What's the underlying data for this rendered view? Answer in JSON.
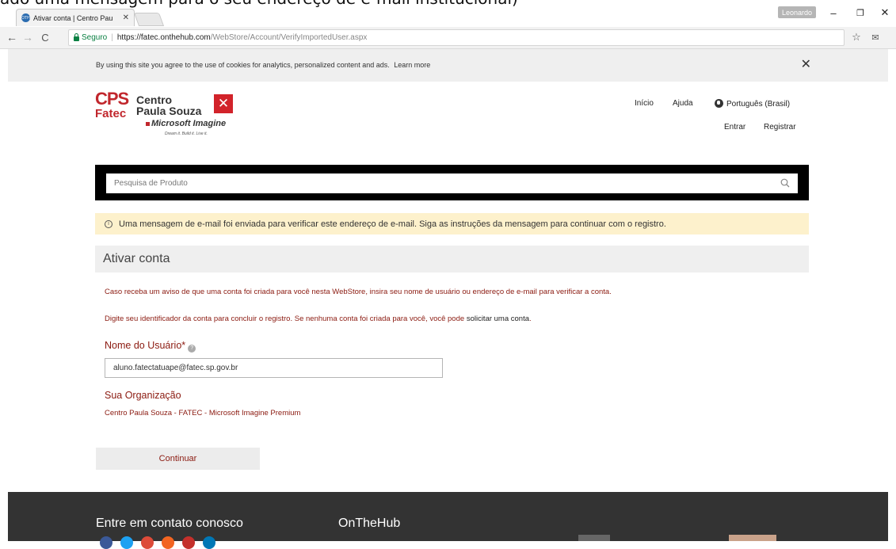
{
  "caption": "ado uma mensagem para o seu endereço de e-mail institucional)",
  "browser": {
    "tab_title": "Ativar conta | Centro Pau",
    "favicon_text": "OTH",
    "user_name": "Leonardo",
    "secure_label": "Seguro",
    "url_host": "https://fatec.onthehub.com",
    "url_path": "/WebStore/Account/VerifyImportedUser.aspx"
  },
  "cookie": {
    "text": "By using this site you agree to the use of cookies for analytics, personalized content and ads.",
    "link": "Learn more"
  },
  "logo": {
    "cps": "CPS",
    "fatec": "Fatec",
    "centro_line1": "Centro",
    "centro_line2": "Paula Souza",
    "imagine": "Microsoft Imagine",
    "tagline": "Dream it. Build it. Live it."
  },
  "nav": {
    "inicio": "Início",
    "ajuda": "Ajuda",
    "language": "Português (Brasil)",
    "entrar": "Entrar",
    "registrar": "Registrar"
  },
  "search": {
    "placeholder": "Pesquisa de Produto"
  },
  "alert": {
    "message": "Uma mensagem de e-mail foi enviada para verificar este endereço de e-mail. Siga as instruções da mensagem para continuar com o registro."
  },
  "section": {
    "title": "Ativar conta",
    "para1": "Caso receba um aviso de que uma conta foi criada para você nesta WebStore, insira seu nome de usuário ou endereço de e-mail para verificar a conta.",
    "para2_prefix": "Digite seu identificador da conta para concluir o registro. Se nenhuma conta foi criada para você, você pode",
    "para2_link": "solicitar uma conta",
    "username_label": "Nome do Usuário*",
    "username_value": "aluno.fatectatuape@fatec.sp.gov.br",
    "org_label": "Sua Organização",
    "org_value": "Centro Paula Souza - FATEC - Microsoft Imagine Premium",
    "continue_label": "Continuar"
  },
  "footer": {
    "contact": "Entre em contato conosco",
    "onthehub": "OnTheHub"
  },
  "colors": {
    "brand_red": "#c1272d",
    "text_maroon": "#8b1a10",
    "alert_bg": "#fdf1cc",
    "footer_bg": "#333333"
  }
}
